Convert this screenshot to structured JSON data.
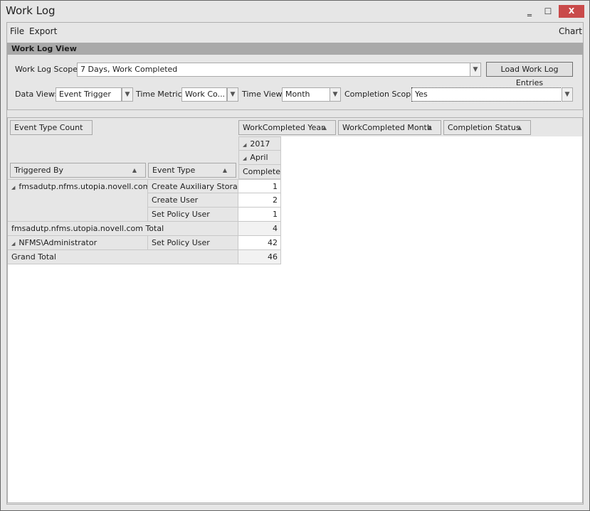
{
  "window": {
    "title": "Work Log",
    "minimize": "‗",
    "maximize": "☐",
    "close": "X"
  },
  "menu": {
    "file": "File",
    "export": "Export",
    "chart": "Chart"
  },
  "group": {
    "title": "Work Log View",
    "scope_label": "Work Log Scope:",
    "scope_value": "7 Days, Work Completed",
    "load_button": "Load Work Log Entries",
    "data_view_label": "Data View:",
    "data_view_value": "Event Trigger",
    "time_metric_label": "Time Metric:",
    "time_metric_value": "Work Co...",
    "time_view_label": "Time View:",
    "time_view_value": "Month",
    "completion_scope_label": "Completion Scope:",
    "completion_scope_value": "Yes"
  },
  "pivot": {
    "data_field": "Event Type Count",
    "column_fields": [
      "WorkCompleted Year",
      "WorkCompleted Month",
      "Completion Status"
    ],
    "row_fields": [
      "Triggered By",
      "Event Type"
    ],
    "col_year": "2017",
    "col_month": "April",
    "col_status": "Completed",
    "groups": [
      {
        "name": "fmsadutp.nfms.utopia.novell.com",
        "rows": [
          {
            "type": "Create Auxiliary Storage",
            "value": "1"
          },
          {
            "type": "Create User",
            "value": "2"
          },
          {
            "type": "Set Policy User",
            "value": "1"
          }
        ],
        "total_label": "fmsadutp.nfms.utopia.novell.com Total",
        "total": "4"
      },
      {
        "name": "NFMS\\Administrator",
        "rows": [
          {
            "type": "Set Policy User",
            "value": "42"
          }
        ]
      }
    ],
    "grand_total_label": "Grand Total",
    "grand_total": "46"
  }
}
